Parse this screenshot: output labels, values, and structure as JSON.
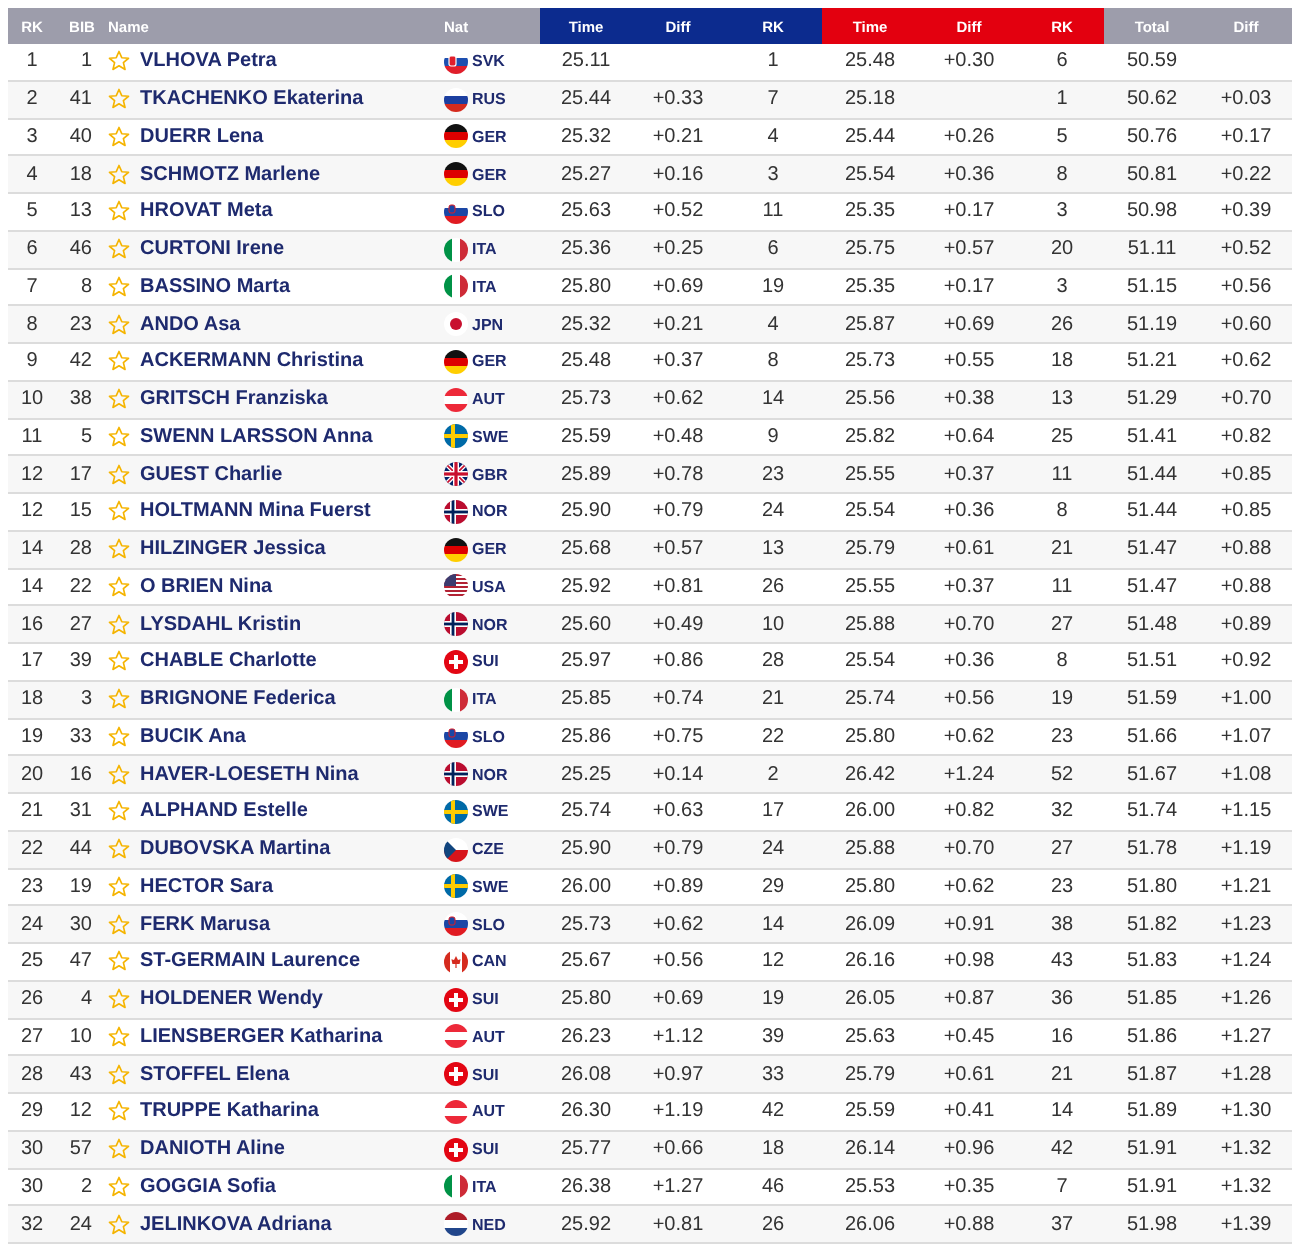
{
  "header": {
    "groups": [
      {
        "color": "#9d9dab",
        "columns": [
          "RK",
          "BIB",
          "Name",
          "Nat"
        ]
      },
      {
        "color": "#0c2b8e",
        "columns": [
          "Time",
          "Diff",
          "RK"
        ]
      },
      {
        "color": "#e3000f",
        "columns": [
          "Time",
          "Diff",
          "RK"
        ]
      },
      {
        "color": "#9d9dab",
        "columns": [
          "Total",
          "Diff"
        ]
      }
    ]
  },
  "rows": [
    {
      "rank": "1",
      "bib": "1",
      "starred": false,
      "name": "VLHOVA Petra",
      "kind": "svk",
      "nation": "SVK",
      "runs": [
        {
          "time": "25.11",
          "rank": "1"
        },
        {
          "time": "25.48",
          "diff": "+0.30",
          "rank": "6"
        }
      ],
      "total": "50.59"
    },
    {
      "rank": "2",
      "bib": "41",
      "starred": false,
      "name": "TKACHENKO Ekaterina",
      "kind": "rus",
      "nation": "RUS",
      "runs": [
        {
          "time": "25.44",
          "diff": "+0.33",
          "rank": "7"
        },
        {
          "time": "25.18",
          "rank": "1"
        }
      ],
      "total": "50.62",
      "diff": "+0.03"
    },
    {
      "rank": "3",
      "bib": "40",
      "starred": false,
      "name": "DUERR Lena",
      "kind": "ger",
      "nation": "GER",
      "runs": [
        {
          "time": "25.32",
          "diff": "+0.21",
          "rank": "4"
        },
        {
          "time": "25.44",
          "diff": "+0.26",
          "rank": "5"
        }
      ],
      "total": "50.76",
      "diff": "+0.17"
    },
    {
      "rank": "4",
      "bib": "18",
      "starred": false,
      "name": "SCHMOTZ Marlene",
      "kind": "ger",
      "nation": "GER",
      "runs": [
        {
          "time": "25.27",
          "diff": "+0.16",
          "rank": "3"
        },
        {
          "time": "25.54",
          "diff": "+0.36",
          "rank": "8"
        }
      ],
      "total": "50.81",
      "diff": "+0.22"
    },
    {
      "rank": "5",
      "bib": "13",
      "starred": false,
      "name": "HROVAT Meta",
      "kind": "slo",
      "nation": "SLO",
      "runs": [
        {
          "time": "25.63",
          "diff": "+0.52",
          "rank": "11"
        },
        {
          "time": "25.35",
          "diff": "+0.17",
          "rank": "3"
        }
      ],
      "total": "50.98",
      "diff": "+0.39"
    },
    {
      "rank": "6",
      "bib": "46",
      "starred": false,
      "name": "CURTONI Irene",
      "kind": "ita",
      "nation": "ITA",
      "runs": [
        {
          "time": "25.36",
          "diff": "+0.25",
          "rank": "6"
        },
        {
          "time": "25.75",
          "diff": "+0.57",
          "rank": "20"
        }
      ],
      "total": "51.11",
      "diff": "+0.52"
    },
    {
      "rank": "7",
      "bib": "8",
      "starred": false,
      "name": "BASSINO Marta",
      "kind": "ita",
      "nation": "ITA",
      "runs": [
        {
          "time": "25.80",
          "diff": "+0.69",
          "rank": "19"
        },
        {
          "time": "25.35",
          "diff": "+0.17",
          "rank": "3"
        }
      ],
      "total": "51.15",
      "diff": "+0.56"
    },
    {
      "rank": "8",
      "bib": "23",
      "starred": false,
      "name": "ANDO Asa",
      "kind": "jpn",
      "nation": "JPN",
      "runs": [
        {
          "time": "25.32",
          "diff": "+0.21",
          "rank": "4"
        },
        {
          "time": "25.87",
          "diff": "+0.69",
          "rank": "26"
        }
      ],
      "total": "51.19",
      "diff": "+0.60"
    },
    {
      "rank": "9",
      "bib": "42",
      "starred": false,
      "name": "ACKERMANN Christina",
      "kind": "ger",
      "nation": "GER",
      "runs": [
        {
          "time": "25.48",
          "diff": "+0.37",
          "rank": "8"
        },
        {
          "time": "25.73",
          "diff": "+0.55",
          "rank": "18"
        }
      ],
      "total": "51.21",
      "diff": "+0.62"
    },
    {
      "rank": "10",
      "bib": "38",
      "starred": false,
      "name": "GRITSCH Franziska",
      "kind": "aut",
      "nation": "AUT",
      "runs": [
        {
          "time": "25.73",
          "diff": "+0.62",
          "rank": "14"
        },
        {
          "time": "25.56",
          "diff": "+0.38",
          "rank": "13"
        }
      ],
      "total": "51.29",
      "diff": "+0.70"
    },
    {
      "rank": "11",
      "bib": "5",
      "starred": false,
      "name": "SWENN LARSSON Anna",
      "kind": "swe",
      "nation": "SWE",
      "runs": [
        {
          "time": "25.59",
          "diff": "+0.48",
          "rank": "9"
        },
        {
          "time": "25.82",
          "diff": "+0.64",
          "rank": "25"
        }
      ],
      "total": "51.41",
      "diff": "+0.82"
    },
    {
      "rank": "12",
      "bib": "17",
      "starred": false,
      "name": "GUEST Charlie",
      "kind": "gbr",
      "nation": "GBR",
      "runs": [
        {
          "time": "25.89",
          "diff": "+0.78",
          "rank": "23"
        },
        {
          "time": "25.55",
          "diff": "+0.37",
          "rank": "11"
        }
      ],
      "total": "51.44",
      "diff": "+0.85"
    },
    {
      "rank": "12",
      "bib": "15",
      "starred": false,
      "name": "HOLTMANN Mina Fuerst",
      "kind": "nor",
      "nation": "NOR",
      "runs": [
        {
          "time": "25.90",
          "diff": "+0.79",
          "rank": "24"
        },
        {
          "time": "25.54",
          "diff": "+0.36",
          "rank": "8"
        }
      ],
      "total": "51.44",
      "diff": "+0.85"
    },
    {
      "rank": "14",
      "bib": "28",
      "starred": false,
      "name": "HILZINGER Jessica",
      "kind": "ger",
      "nation": "GER",
      "runs": [
        {
          "time": "25.68",
          "diff": "+0.57",
          "rank": "13"
        },
        {
          "time": "25.79",
          "diff": "+0.61",
          "rank": "21"
        }
      ],
      "total": "51.47",
      "diff": "+0.88"
    },
    {
      "rank": "14",
      "bib": "22",
      "starred": false,
      "name": "O BRIEN Nina",
      "kind": "usa",
      "nation": "USA",
      "runs": [
        {
          "time": "25.92",
          "diff": "+0.81",
          "rank": "26"
        },
        {
          "time": "25.55",
          "diff": "+0.37",
          "rank": "11"
        }
      ],
      "total": "51.47",
      "diff": "+0.88"
    },
    {
      "rank": "16",
      "bib": "27",
      "starred": false,
      "name": "LYSDAHL Kristin",
      "kind": "nor",
      "nation": "NOR",
      "runs": [
        {
          "time": "25.60",
          "diff": "+0.49",
          "rank": "10"
        },
        {
          "time": "25.88",
          "diff": "+0.70",
          "rank": "27"
        }
      ],
      "total": "51.48",
      "diff": "+0.89"
    },
    {
      "rank": "17",
      "bib": "39",
      "starred": false,
      "name": "CHABLE Charlotte",
      "kind": "sui",
      "nation": "SUI",
      "runs": [
        {
          "time": "25.97",
          "diff": "+0.86",
          "rank": "28"
        },
        {
          "time": "25.54",
          "diff": "+0.36",
          "rank": "8"
        }
      ],
      "total": "51.51",
      "diff": "+0.92"
    },
    {
      "rank": "18",
      "bib": "3",
      "starred": false,
      "name": "BRIGNONE Federica",
      "kind": "ita",
      "nation": "ITA",
      "runs": [
        {
          "time": "25.85",
          "diff": "+0.74",
          "rank": "21"
        },
        {
          "time": "25.74",
          "diff": "+0.56",
          "rank": "19"
        }
      ],
      "total": "51.59",
      "diff": "+1.00"
    },
    {
      "rank": "19",
      "bib": "33",
      "starred": false,
      "name": "BUCIK Ana",
      "kind": "slo",
      "nation": "SLO",
      "runs": [
        {
          "time": "25.86",
          "diff": "+0.75",
          "rank": "22"
        },
        {
          "time": "25.80",
          "diff": "+0.62",
          "rank": "23"
        }
      ],
      "total": "51.66",
      "diff": "+1.07"
    },
    {
      "rank": "20",
      "bib": "16",
      "starred": false,
      "name": "HAVER-LOESETH Nina",
      "kind": "nor",
      "nation": "NOR",
      "runs": [
        {
          "time": "25.25",
          "diff": "+0.14",
          "rank": "2"
        },
        {
          "time": "26.42",
          "diff": "+1.24",
          "rank": "52"
        }
      ],
      "total": "51.67",
      "diff": "+1.08"
    },
    {
      "rank": "21",
      "bib": "31",
      "starred": false,
      "name": "ALPHAND Estelle",
      "kind": "swe",
      "nation": "SWE",
      "runs": [
        {
          "time": "25.74",
          "diff": "+0.63",
          "rank": "17"
        },
        {
          "time": "26.00",
          "diff": "+0.82",
          "rank": "32"
        }
      ],
      "total": "51.74",
      "diff": "+1.15"
    },
    {
      "rank": "22",
      "bib": "44",
      "starred": false,
      "name": "DUBOVSKA Martina",
      "kind": "cze",
      "nation": "CZE",
      "runs": [
        {
          "time": "25.90",
          "diff": "+0.79",
          "rank": "24"
        },
        {
          "time": "25.88",
          "diff": "+0.70",
          "rank": "27"
        }
      ],
      "total": "51.78",
      "diff": "+1.19"
    },
    {
      "rank": "23",
      "bib": "19",
      "starred": false,
      "name": "HECTOR Sara",
      "kind": "swe",
      "nation": "SWE",
      "runs": [
        {
          "time": "26.00",
          "diff": "+0.89",
          "rank": "29"
        },
        {
          "time": "25.80",
          "diff": "+0.62",
          "rank": "23"
        }
      ],
      "total": "51.80",
      "diff": "+1.21"
    },
    {
      "rank": "24",
      "bib": "30",
      "starred": false,
      "name": "FERK Marusa",
      "kind": "slo",
      "nation": "SLO",
      "runs": [
        {
          "time": "25.73",
          "diff": "+0.62",
          "rank": "14"
        },
        {
          "time": "26.09",
          "diff": "+0.91",
          "rank": "38"
        }
      ],
      "total": "51.82",
      "diff": "+1.23"
    },
    {
      "rank": "25",
      "bib": "47",
      "starred": false,
      "name": "ST-GERMAIN Laurence",
      "kind": "can",
      "nation": "CAN",
      "runs": [
        {
          "time": "25.67",
          "diff": "+0.56",
          "rank": "12"
        },
        {
          "time": "26.16",
          "diff": "+0.98",
          "rank": "43"
        }
      ],
      "total": "51.83",
      "diff": "+1.24"
    },
    {
      "rank": "26",
      "bib": "4",
      "starred": false,
      "name": "HOLDENER Wendy",
      "kind": "sui",
      "nation": "SUI",
      "runs": [
        {
          "time": "25.80",
          "diff": "+0.69",
          "rank": "19"
        },
        {
          "time": "26.05",
          "diff": "+0.87",
          "rank": "36"
        }
      ],
      "total": "51.85",
      "diff": "+1.26"
    },
    {
      "rank": "27",
      "bib": "10",
      "starred": false,
      "name": "LIENSBERGER Katharina",
      "kind": "aut",
      "nation": "AUT",
      "runs": [
        {
          "time": "26.23",
          "diff": "+1.12",
          "rank": "39"
        },
        {
          "time": "25.63",
          "diff": "+0.45",
          "rank": "16"
        }
      ],
      "total": "51.86",
      "diff": "+1.27"
    },
    {
      "rank": "28",
      "bib": "43",
      "starred": false,
      "name": "STOFFEL Elena",
      "kind": "sui",
      "nation": "SUI",
      "runs": [
        {
          "time": "26.08",
          "diff": "+0.97",
          "rank": "33"
        },
        {
          "time": "25.79",
          "diff": "+0.61",
          "rank": "21"
        }
      ],
      "total": "51.87",
      "diff": "+1.28"
    },
    {
      "rank": "29",
      "bib": "12",
      "starred": false,
      "name": "TRUPPE Katharina",
      "kind": "aut",
      "nation": "AUT",
      "runs": [
        {
          "time": "26.30",
          "diff": "+1.19",
          "rank": "42"
        },
        {
          "time": "25.59",
          "diff": "+0.41",
          "rank": "14"
        }
      ],
      "total": "51.89",
      "diff": "+1.30"
    },
    {
      "rank": "30",
      "bib": "57",
      "starred": false,
      "name": "DANIOTH Aline",
      "kind": "sui",
      "nation": "SUI",
      "runs": [
        {
          "time": "25.77",
          "diff": "+0.66",
          "rank": "18"
        },
        {
          "time": "26.14",
          "diff": "+0.96",
          "rank": "42"
        }
      ],
      "total": "51.91",
      "diff": "+1.32"
    },
    {
      "rank": "30",
      "bib": "2",
      "starred": false,
      "name": "GOGGIA Sofia",
      "kind": "ita",
      "nation": "ITA",
      "runs": [
        {
          "time": "26.38",
          "diff": "+1.27",
          "rank": "46"
        },
        {
          "time": "25.53",
          "diff": "+0.35",
          "rank": "7"
        }
      ],
      "total": "51.91",
      "diff": "+1.32"
    },
    {
      "rank": "32",
      "bib": "24",
      "starred": false,
      "name": "JELINKOVA Adriana",
      "kind": "ned",
      "nation": "NED",
      "runs": [
        {
          "time": "25.92",
          "diff": "+0.81",
          "rank": "26"
        },
        {
          "time": "26.06",
          "diff": "+0.88",
          "rank": "37"
        }
      ],
      "total": "51.98",
      "diff": "+1.39"
    }
  ]
}
